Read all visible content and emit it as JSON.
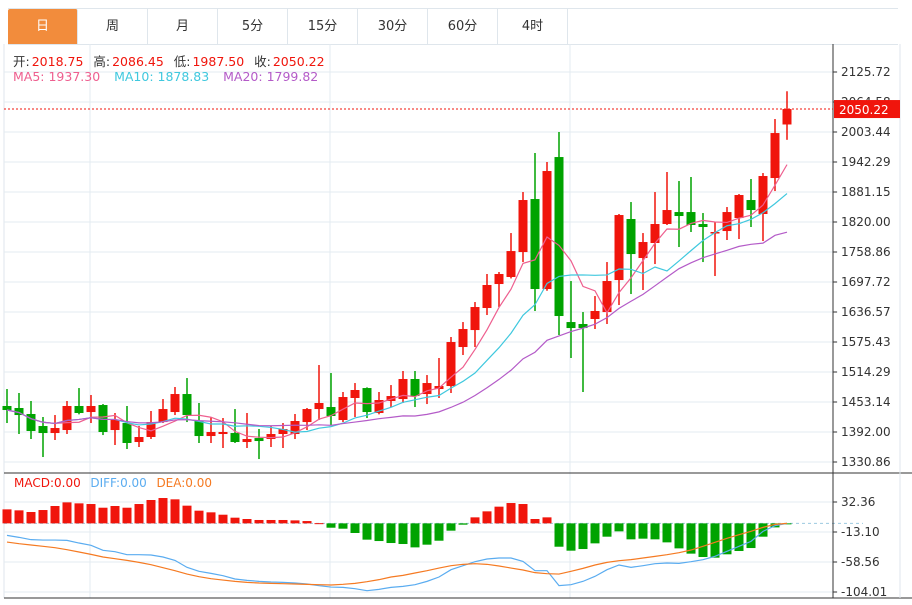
{
  "tabs": [
    {
      "label": "日",
      "active": true
    },
    {
      "label": "周"
    },
    {
      "label": "月"
    },
    {
      "label": "5分"
    },
    {
      "label": "15分"
    },
    {
      "label": "30分"
    },
    {
      "label": "60分"
    },
    {
      "label": "4时"
    }
  ],
  "ohlc_legend": {
    "open_label": "开:",
    "open": "2018.75",
    "high_label": "高:",
    "high": "2086.45",
    "low_label": "低:",
    "low": "1987.50",
    "close_label": "收:",
    "close": "2050.22"
  },
  "ma_legend": {
    "ma5": "MA5: 1937.30",
    "ma10": "MA10: 1878.83",
    "ma20": "MA20: 1799.82"
  },
  "macd_legend": {
    "macd": "MACD:0.00",
    "diff": "DIFF:0.00",
    "dea": "DEA:0.00"
  },
  "colors": {
    "up": "#f0150c",
    "down": "#00a300",
    "ma5": "#ee5f8f",
    "ma10": "#3fc8de",
    "ma20": "#b45bc8",
    "diff": "#5aacf0",
    "dea": "#f57a22",
    "active_tab": "#f28c3c"
  },
  "chart_data": [
    {
      "type": "candlestick",
      "price_ticks": [
        "2125.72",
        "2064.58",
        "2003.44",
        "1942.29",
        "1881.15",
        "1820.00",
        "1758.86",
        "1697.72",
        "1636.57",
        "1575.43",
        "1514.29",
        "1453.14",
        "1392.00",
        "1330.86"
      ],
      "ylim": [
        1330.86,
        2125.72
      ],
      "current_price": "2050.22",
      "grid": true,
      "moving_averages": [
        5,
        10,
        20
      ],
      "candles_ohlc": [
        [
          1445.0,
          1479.6,
          1410.3,
          1436.8
        ],
        [
          1440.9,
          1471.5,
          1387.9,
          1426.6
        ],
        [
          1428.7,
          1455.2,
          1377.7,
          1394.0
        ],
        [
          1404.2,
          1422.6,
          1341.0,
          1389.9
        ],
        [
          1389.9,
          1426.6,
          1375.7,
          1400.1
        ],
        [
          1396.0,
          1455.2,
          1387.9,
          1445.0
        ],
        [
          1445.0,
          1481.6,
          1428.0,
          1430.7
        ],
        [
          1432.7,
          1467.4,
          1410.3,
          1445.0
        ],
        [
          1447.0,
          1449.0,
          1385.8,
          1392.0
        ],
        [
          1396.0,
          1430.7,
          1365.5,
          1416.4
        ],
        [
          1410.3,
          1445.0,
          1357.3,
          1369.6
        ],
        [
          1371.6,
          1404.2,
          1361.4,
          1381.8
        ],
        [
          1381.8,
          1434.8,
          1377.7,
          1412.3
        ],
        [
          1412.3,
          1459.2,
          1410.3,
          1438.8
        ],
        [
          1432.7,
          1483.7,
          1426.6,
          1469.4
        ],
        [
          1469.4,
          1502.0,
          1412.3,
          1426.6
        ],
        [
          1414.4,
          1451.1,
          1369.6,
          1383.8
        ],
        [
          1383.8,
          1422.6,
          1369.6,
          1392.0
        ],
        [
          1387.9,
          1420.5,
          1359.4,
          1392.0
        ],
        [
          1389.9,
          1438.8,
          1369.6,
          1371.6
        ],
        [
          1371.6,
          1430.7,
          1359.4,
          1377.7
        ],
        [
          1379.7,
          1398.1,
          1336.9,
          1373.6
        ],
        [
          1377.7,
          1404.2,
          1361.4,
          1387.9
        ],
        [
          1387.9,
          1410.3,
          1359.4,
          1398.1
        ],
        [
          1387.9,
          1428.7,
          1377.7,
          1414.4
        ],
        [
          1412.3,
          1440.9,
          1396.0,
          1438.8
        ],
        [
          1438.8,
          1528.5,
          1416.4,
          1451.1
        ],
        [
          1442.9,
          1512.2,
          1406.2,
          1424.6
        ],
        [
          1416.4,
          1473.5,
          1412.3,
          1463.3
        ],
        [
          1461.3,
          1491.8,
          1422.6,
          1477.6
        ],
        [
          1481.6,
          1483.0,
          1420.5,
          1432.7
        ],
        [
          1430.7,
          1473.5,
          1428.0,
          1457.2
        ],
        [
          1455.2,
          1487.7,
          1442.9,
          1465.3
        ],
        [
          1459.2,
          1516.3,
          1451.1,
          1500.0
        ],
        [
          1500.0,
          1516.3,
          1442.9,
          1465.3
        ],
        [
          1469.4,
          1508.1,
          1449.0,
          1491.8
        ],
        [
          1479.6,
          1542.8,
          1461.3,
          1485.7
        ],
        [
          1485.7,
          1585.6,
          1471.5,
          1575.4
        ],
        [
          1565.2,
          1616.1,
          1548.9,
          1601.9
        ],
        [
          1599.8,
          1656.9,
          1565.2,
          1646.7
        ],
        [
          1644.7,
          1714.0,
          1630.4,
          1691.6
        ],
        [
          1693.6,
          1718.1,
          1646.7,
          1714.0
        ],
        [
          1707.9,
          1797.5,
          1705.0,
          1760.8
        ],
        [
          1758.8,
          1881.1,
          1738.4,
          1864.8
        ],
        [
          1866.8,
          1960.6,
          1638.6,
          1683.4
        ],
        [
          1683.4,
          1942.2,
          1680.0,
          1923.9
        ],
        [
          1952.4,
          2003.4,
          1589.7,
          1628.4
        ],
        [
          1616.1,
          1699.7,
          1542.8,
          1603.9
        ],
        [
          1612.1,
          1636.5,
          1473.5,
          1603.9
        ],
        [
          1622.3,
          1669.1,
          1601.9,
          1638.6
        ],
        [
          1636.5,
          1738.4,
          1612.1,
          1699.7
        ],
        [
          1701.7,
          1836.3,
          1650.8,
          1834.2
        ],
        [
          1826.1,
          1860.7,
          1673.2,
          1754.7
        ],
        [
          1746.6,
          1797.5,
          1681.4,
          1779.2
        ],
        [
          1777.2,
          1881.1,
          1734.3,
          1815.9
        ],
        [
          1815.9,
          1921.9,
          1813.9,
          1844.4
        ],
        [
          1840.3,
          1903.5,
          1769.0,
          1832.2
        ],
        [
          1840.3,
          1911.7,
          1799.6,
          1813.9
        ],
        [
          1815.9,
          1838.3,
          1738.4,
          1809.8
        ],
        [
          1797.5,
          1819.9,
          1709.9,
          1799.6
        ],
        [
          1801.6,
          1850.5,
          1783.3,
          1840.3
        ],
        [
          1828.1,
          1877.0,
          1785.3,
          1875.0
        ],
        [
          1864.8,
          1907.6,
          1809.8,
          1844.4
        ],
        [
          1836.3,
          1919.8,
          1781.2,
          1913.7
        ],
        [
          1909.6,
          2029.9,
          1883.1,
          2001.3
        ],
        [
          2018.75,
          2086.45,
          1987.5,
          2050.22
        ]
      ]
    },
    {
      "type": "macd",
      "ticks": [
        "32.36",
        "-13.10",
        "-58.56",
        "-104.01"
      ],
      "ylim": [
        -104.01,
        32.36
      ],
      "histogram": [
        21.2,
        19.7,
        17.2,
        20.2,
        26.3,
        31.8,
        30.3,
        29.3,
        23.7,
        26.3,
        23.7,
        29.3,
        35.4,
        38.4,
        36.4,
        26.8,
        19.2,
        16.7,
        13.1,
        8.6,
        6.6,
        5.1,
        5.1,
        5.1,
        4.5,
        3.5,
        0.3,
        -6.6,
        -8.1,
        -14.6,
        -24.7,
        -26.8,
        -29.8,
        -31.3,
        -36.4,
        -32.3,
        -26.3,
        -11.1,
        -2.0,
        9.1,
        18.2,
        25.3,
        30.8,
        29.3,
        6.6,
        9.1,
        -35.4,
        -41.4,
        -38.9,
        -30.3,
        -20.2,
        -12.1,
        -24.2,
        -23.2,
        -24.2,
        -28.8,
        -37.9,
        -45.9,
        -51.0,
        -52.0,
        -46.9,
        -41.9,
        -37.4,
        -20.2,
        -6.1,
        -0.5
      ],
      "diff": [
        -18.2,
        -21.2,
        -24.7,
        -25.3,
        -25.3,
        -25.8,
        -29.8,
        -33.3,
        -40.9,
        -42.9,
        -47.5,
        -47.5,
        -48.0,
        -51.0,
        -56.1,
        -66.7,
        -72.7,
        -75.8,
        -79.3,
        -84.3,
        -86.4,
        -87.9,
        -88.9,
        -89.4,
        -90.4,
        -91.9,
        -94.4,
        -96.5,
        -97.0,
        -99.0,
        -102.0,
        -100.0,
        -97.0,
        -95.5,
        -92.9,
        -87.9,
        -81.3,
        -70.2,
        -64.1,
        -58.1,
        -54.0,
        -52.5,
        -52.5,
        -57.6,
        -71.7,
        -71.7,
        -94.4,
        -92.9,
        -87.9,
        -80.3,
        -70.2,
        -63.1,
        -66.7,
        -64.1,
        -61.1,
        -60.1,
        -60.6,
        -58.1,
        -55.0,
        -50.0,
        -42.4,
        -34.8,
        -27.3,
        -12.1,
        -3.5,
        0.0
      ],
      "dea": [
        -28.3,
        -30.8,
        -32.8,
        -34.8,
        -36.9,
        -39.9,
        -43.4,
        -47.0,
        -51.0,
        -53.5,
        -56.1,
        -59.1,
        -62.6,
        -67.2,
        -71.7,
        -76.8,
        -80.8,
        -83.8,
        -85.9,
        -87.9,
        -89.4,
        -90.4,
        -90.9,
        -91.4,
        -91.9,
        -92.4,
        -92.9,
        -93.4,
        -92.4,
        -90.9,
        -88.4,
        -85.3,
        -81.3,
        -78.8,
        -75.2,
        -71.7,
        -67.7,
        -64.1,
        -62.1,
        -61.1,
        -62.1,
        -64.6,
        -67.7,
        -70.7,
        -74.7,
        -76.3,
        -76.8,
        -72.7,
        -68.2,
        -63.1,
        -59.1,
        -56.6,
        -55.0,
        -52.5,
        -50.0,
        -47.5,
        -44.4,
        -40.4,
        -34.8,
        -28.8,
        -22.7,
        -17.2,
        -12.1,
        -6.1,
        -1.5,
        0.0
      ]
    }
  ]
}
